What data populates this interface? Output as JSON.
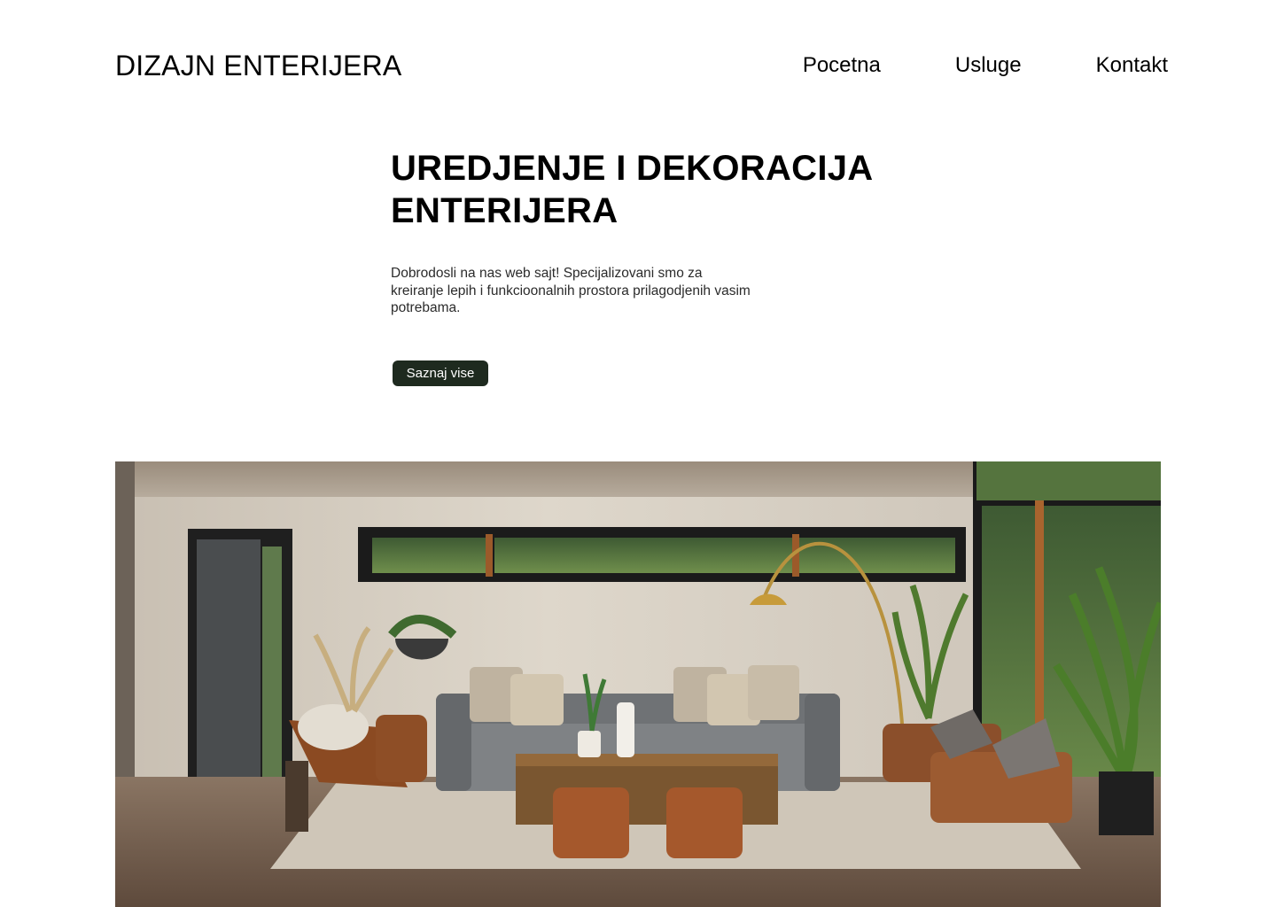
{
  "header": {
    "logo": "DIZAJN ENTERIJERA",
    "nav": [
      "Pocetna",
      "Usluge",
      "Kontakt"
    ]
  },
  "hero": {
    "title_line1": "UREDJENJE I DEKORACIJA",
    "title_line2": "ENTERIJERA",
    "description": "Dobrodosli na nas web sajt! Specijalizovani smo za kreiranje lepih i funkcioonalnih prostora prilagodjenih vasim potrebama.",
    "cta_label": "Saznaj vise"
  },
  "colors": {
    "cta_background": "#1e2a1f",
    "text": "#000000",
    "background": "#ffffff"
  },
  "image": {
    "subject": "living-room-interior-photo"
  }
}
